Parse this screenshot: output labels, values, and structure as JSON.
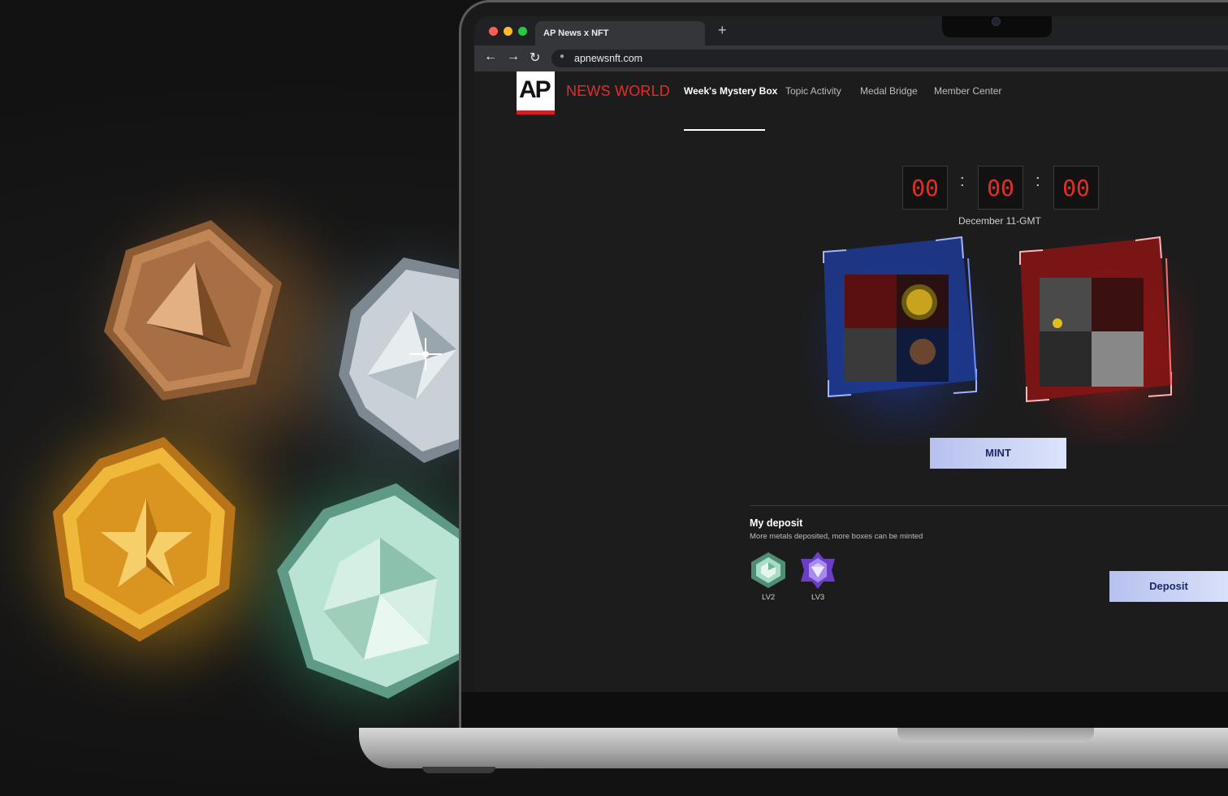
{
  "browser": {
    "tab_title": "AP News x NFT",
    "new_tab": "+",
    "url": "apnewsnft.com",
    "icons": [
      "back-arrow-icon",
      "forward-arrow-icon",
      "reload-icon",
      "lock-icon"
    ]
  },
  "site": {
    "logo_text": "AP",
    "brand": "NEWS WORLD",
    "nav": [
      {
        "label": "Week's Mystery Box",
        "active": true
      },
      {
        "label": "Topic Activity",
        "active": false
      },
      {
        "label": "Medal Bridge",
        "active": false
      },
      {
        "label": "Member Center",
        "active": false
      }
    ]
  },
  "countdown": {
    "hours": "00",
    "minutes": "00",
    "seconds": "00",
    "separator": ":",
    "date": "December 11-GMT"
  },
  "mystery_boxes": [
    {
      "color": "blue"
    },
    {
      "color": "red"
    }
  ],
  "mint": {
    "label": "MINT"
  },
  "deposit": {
    "title": "My deposit",
    "subtitle": "More metals deposited, more boxes can be minted",
    "gems": [
      {
        "label": "LV2",
        "icon": "green-gem-icon"
      },
      {
        "label": "LV3",
        "icon": "purple-gem-icon"
      }
    ],
    "button": "Deposit"
  },
  "colors": {
    "accent_red": "#e52d27",
    "button_gradient_start": "#b7c1ee",
    "button_gradient_end": "#dde3fa",
    "bronze": "#b07a4a",
    "silver": "#b9c2c8",
    "gold": "#e8a728",
    "jade": "#a9d8c4"
  },
  "medals": [
    "bronze-medal-icon",
    "silver-medal-icon",
    "gold-medal-icon",
    "jade-medal-icon"
  ]
}
